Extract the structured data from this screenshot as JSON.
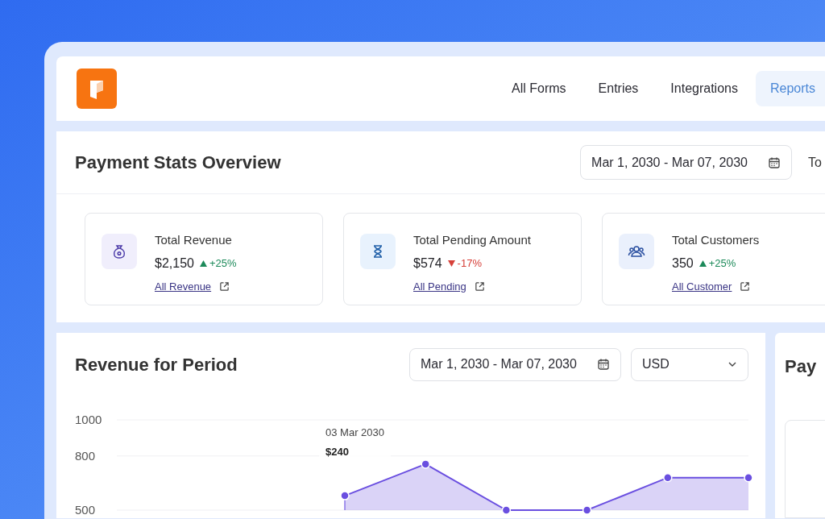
{
  "nav": [
    {
      "label": "All Forms",
      "selected": false
    },
    {
      "label": "Entries",
      "selected": false
    },
    {
      "label": "Integrations",
      "selected": false
    },
    {
      "label": "Reports",
      "selected": true
    }
  ],
  "overview": {
    "title": "Payment Stats Overview",
    "date_range": "Mar 1, 2030 - Mar 07, 2030",
    "column_2": "To",
    "cards": [
      {
        "kind": "revenue",
        "title": "Total Revenue",
        "value": "$2,150",
        "rising": true,
        "change": "+25%",
        "link": "All Revenue"
      },
      {
        "kind": "pending",
        "title": "Total Pending Amount",
        "value": "$574",
        "rising": false,
        "change": "-17%",
        "link": "All Pending"
      },
      {
        "kind": "customers",
        "title": "Total Customers",
        "value": "350",
        "rising": true,
        "change": "+25%",
        "link": "All Customer"
      }
    ]
  },
  "revenue": {
    "title": "Revenue for Period",
    "date_range": "Mar 1, 2030 - Mar 07, 2030",
    "currency": "USD",
    "chart_data": {
      "type": "area",
      "ylim": [
        500,
        1000
      ],
      "yticks": [
        1000,
        800,
        500
      ],
      "series": [
        {
          "color": "#6a4fe0",
          "values": [
            580,
            755,
            500,
            500,
            680,
            680
          ]
        }
      ]
    },
    "tooltip": {
      "date": "03 Mar 2030",
      "amount": "$240"
    }
  },
  "side_panel": {
    "title": "Pay"
  }
}
